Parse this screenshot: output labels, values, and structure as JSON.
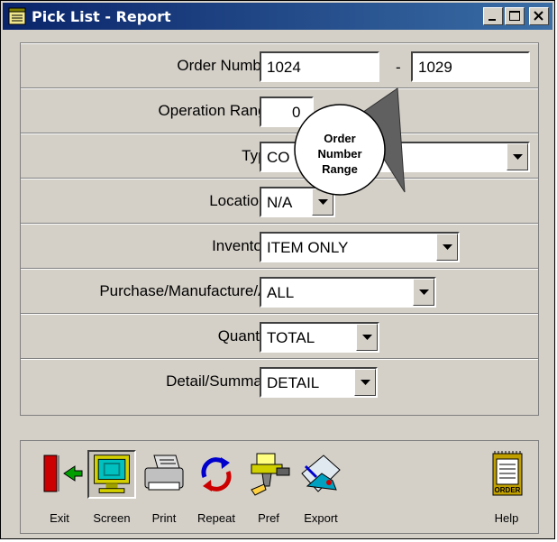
{
  "window": {
    "title": "Pick List - Report",
    "controls": {
      "minimize": "min-icon",
      "maximize": "max-icon",
      "close": "close-icon"
    }
  },
  "form": {
    "order_number": {
      "label": "Order Number",
      "from": "1024",
      "separator": "-",
      "to": "1029"
    },
    "operation_range": {
      "label": "Operation Range",
      "value": "0"
    },
    "type": {
      "label": "Type",
      "value": "CO"
    },
    "locations": {
      "label": "Locations",
      "value": "N/A"
    },
    "inventory": {
      "label": "Inventory",
      "value": "ITEM ONLY"
    },
    "purchase_manufacture": {
      "label": "Purchase/Manufacture/All",
      "value": "ALL"
    },
    "quantity": {
      "label": "Quantity",
      "value": "TOTAL"
    },
    "detail_summary": {
      "label": "Detail/Summary",
      "value": "DETAIL"
    }
  },
  "callout": {
    "line1": "Order",
    "line2": "Number",
    "line3": "Range"
  },
  "toolbar": {
    "exit": "Exit",
    "screen": "Screen",
    "print": "Print",
    "repeat": "Repeat",
    "pref": "Pref",
    "export": "Export",
    "help": "Help",
    "help_icon_text": "ORDER"
  },
  "colors": {
    "title_bar": "#0a246a",
    "window_bg": "#d4d0c8",
    "exit_red": "#cc0000",
    "screen_cyan": "#00c0c0"
  }
}
